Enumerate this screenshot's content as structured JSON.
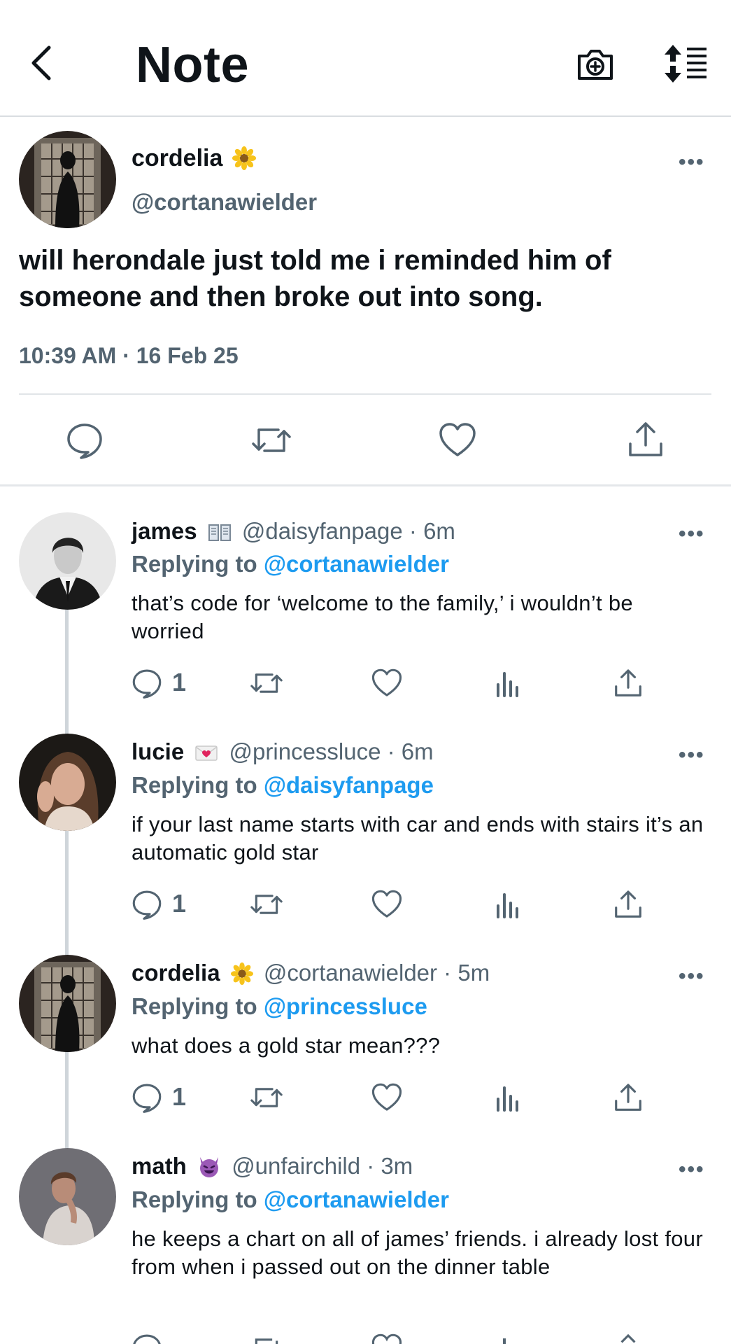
{
  "header": {
    "title": "Note"
  },
  "main_tweet": {
    "name": "cordelia",
    "handle": "@cortanawielder",
    "text": "will herondale just told me i reminded him of someone and then broke out into song.",
    "timestamp": "10:39 AM · 16 Feb 25",
    "more": "•••"
  },
  "replies": [
    {
      "name": "james",
      "meta": "@daisyfanpage · 6m",
      "replying_label": "Replying to",
      "mention": "@cortanawielder",
      "text": "that’s code for ‘welcome to the family,’ i wouldn’t be worried",
      "reply_count": "1",
      "more": "•••"
    },
    {
      "name": "lucie",
      "meta": "@princessluce · 6m",
      "replying_label": "Replying to",
      "mention": "@daisyfanpage",
      "text": "if your last name starts with car and ends with stairs it’s an automatic gold star",
      "reply_count": "1",
      "more": "•••"
    },
    {
      "name": "cordelia",
      "meta": "@cortanawielder · 5m",
      "replying_label": "Replying to",
      "mention": "@princessluce",
      "text": "what does a gold star mean???",
      "reply_count": "1",
      "more": "•••"
    },
    {
      "name": "math",
      "meta": "@unfairchild · 3m",
      "replying_label": "Replying to",
      "mention": "@cortanawielder",
      "text": "he keeps a chart on all of james’ friends. i already lost four from when i passed out on the dinner table",
      "more": "•••"
    }
  ],
  "colors": {
    "accent": "#1d9bf0",
    "secondary_text": "#536471",
    "text": "#0f1419"
  }
}
